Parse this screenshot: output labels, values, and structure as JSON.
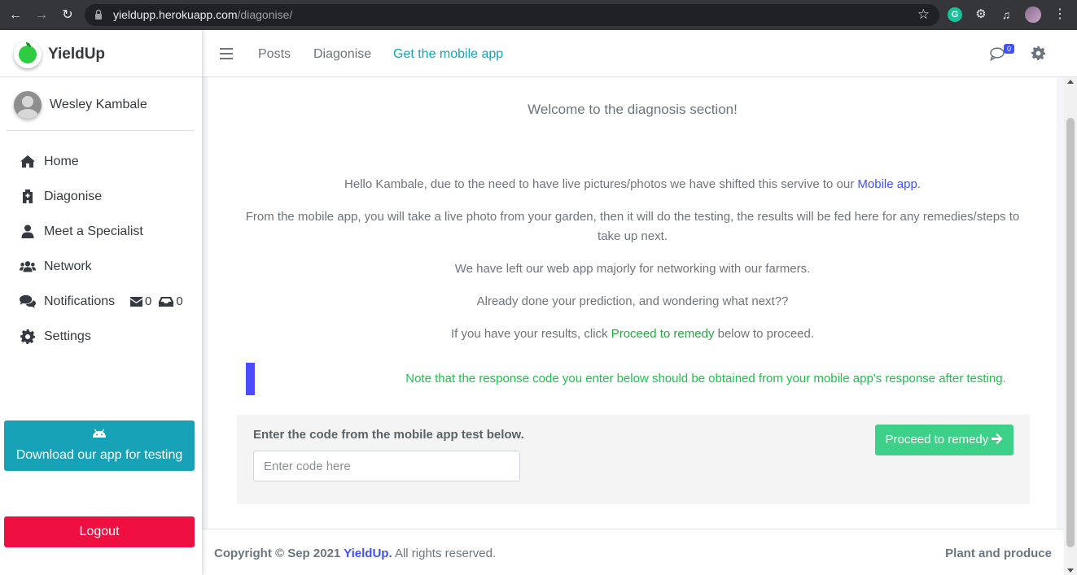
{
  "browser": {
    "url_host": "yieldupp.herokuapp.com",
    "url_path": "/diagonise/",
    "icons": [
      "back-icon",
      "forward-icon",
      "reload-icon",
      "lock-icon",
      "star-icon",
      "grammarly-icon",
      "extensions-icon",
      "media-icon",
      "profile-avatar",
      "kebab-menu-icon"
    ]
  },
  "sidebar": {
    "brand": "YieldUp",
    "user_name": "Wesley Kambale",
    "items": [
      {
        "label": "Home",
        "icon": "home-icon"
      },
      {
        "label": "Diagonise",
        "icon": "hospital-icon"
      },
      {
        "label": "Meet a Specialist",
        "icon": "user-icon"
      },
      {
        "label": "Network",
        "icon": "users-icon"
      },
      {
        "label": "Notifications",
        "icon": "comments-icon"
      },
      {
        "label": "Settings",
        "icon": "gear-icon"
      }
    ],
    "notif_mail_count": "0",
    "notif_inbox_count": "0",
    "download_label": "Download our app for testing",
    "logout_label": "Logout"
  },
  "topnav": {
    "links": [
      "Posts",
      "Diagonise",
      "Get the mobile app"
    ],
    "chat_badge": "0"
  },
  "main": {
    "welcome": "Welcome to the diagnosis section!",
    "p1_pre": "Hello Kambale, due to the need to have live pictures/photos we have shifted this servive to our ",
    "p1_link": "Mobile app",
    "p1_post": ".",
    "p2": "From the mobile app, you will take a live photo from your garden, then it will do the testing, the results will be fed here for any remedies/steps to take up next.",
    "p3": "We have left our web app majorly for networking with our farmers.",
    "p4": "Already done your prediction, and wondering what next??",
    "p5_pre": "If you have your results, click ",
    "p5_link": "Proceed to remedy",
    "p5_post": " below to proceed.",
    "callout": "Note that the response code you enter below should be obtained from your mobile app's response after testing.",
    "code_label": "Enter the code from the mobile app test below.",
    "code_placeholder": "Enter code here",
    "proceed_label": "Proceed to remedy"
  },
  "footer": {
    "copy_pre": "Copyright © Sep 2021 ",
    "copy_brand": "YieldUp.",
    "copy_post": " All rights reserved.",
    "tagline": "Plant and produce"
  },
  "colors": {
    "accent_teal": "#17a2b8",
    "logout_red": "#ef0f40",
    "proceed_green": "#3dd088",
    "link_blue": "#3f51ff",
    "callout_green": "#1ec14b"
  }
}
